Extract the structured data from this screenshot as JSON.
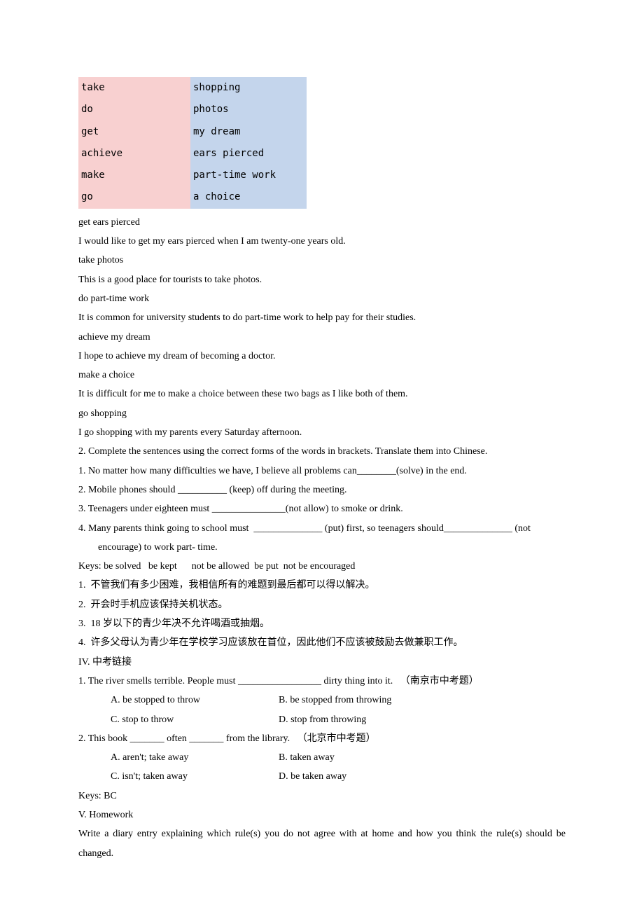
{
  "match_table": {
    "left": [
      "take",
      "do",
      "get",
      "achieve",
      "make",
      "go"
    ],
    "right": [
      "shopping",
      "photos",
      "my dream",
      "ears pierced",
      "part-time work",
      "a choice"
    ]
  },
  "pairs": [
    {
      "phrase": "get ears pierced",
      "sentence": "I would like to get my ears pierced when I am twenty-one years old."
    },
    {
      "phrase": "take photos",
      "sentence": "This is a good place for tourists to take photos."
    },
    {
      "phrase": "do part-time work",
      "sentence": "It is common for university students to do part-time work to help pay for their studies."
    },
    {
      "phrase": "achieve my dream",
      "sentence": "I hope to achieve my dream of becoming a doctor."
    },
    {
      "phrase": "make a choice",
      "sentence": "It is difficult for me to make a choice between these two bags as I like both of them."
    },
    {
      "phrase": "go shopping",
      "sentence": "I go shopping with my parents every Saturday afternoon."
    }
  ],
  "ex2_intro": "2. Complete the sentences using the correct forms of the words in brackets. Translate them into Chinese.",
  "ex2_items": [
    "1. No matter how many difficulties we have, I believe all problems can________(solve) in the end.",
    "2. Mobile phones should __________ (keep) off during the meeting.",
    "3. Teenagers under eighteen must _______________(not allow) to smoke or drink.",
    "4. Many parents think going to school must  ______________ (put) first, so teenagers should______________ (not encourage) to work part- time."
  ],
  "ex2_keys": "Keys: be solved   be kept      not be allowed  be put  not be encouraged",
  "ex2_translations": [
    "1.  不管我们有多少困难，我相信所有的难题到最后都可以得以解决。",
    "2.  开会时手机应该保持关机状态。",
    "3.  18 岁以下的青少年决不允许喝酒或抽烟。",
    "4.  许多父母认为青少年在学校学习应该放在首位，因此他们不应该被鼓励去做兼职工作。"
  ],
  "section4_title": "IV. 中考链接",
  "q1": {
    "stem": "1. The river smells terrible. People must _________________ dirty thing into it.   （南京市中考题）",
    "opts": [
      [
        "A. be stopped to throw",
        "B. be stopped from throwing"
      ],
      [
        "C. stop to throw",
        "D. stop from throwing"
      ]
    ]
  },
  "q2": {
    "stem": "2. This book _______ often _______ from the library.   （北京市中考题）",
    "opts": [
      [
        "A. aren't; take away",
        "B. taken away"
      ],
      [
        "C. isn't; taken away",
        "D. be taken away"
      ]
    ]
  },
  "keys_bc": "Keys: BC",
  "section5_title": "V. Homework",
  "homework": "Write a diary entry explaining which rule(s) you do not agree with at home and how you think the rule(s) should be changed."
}
